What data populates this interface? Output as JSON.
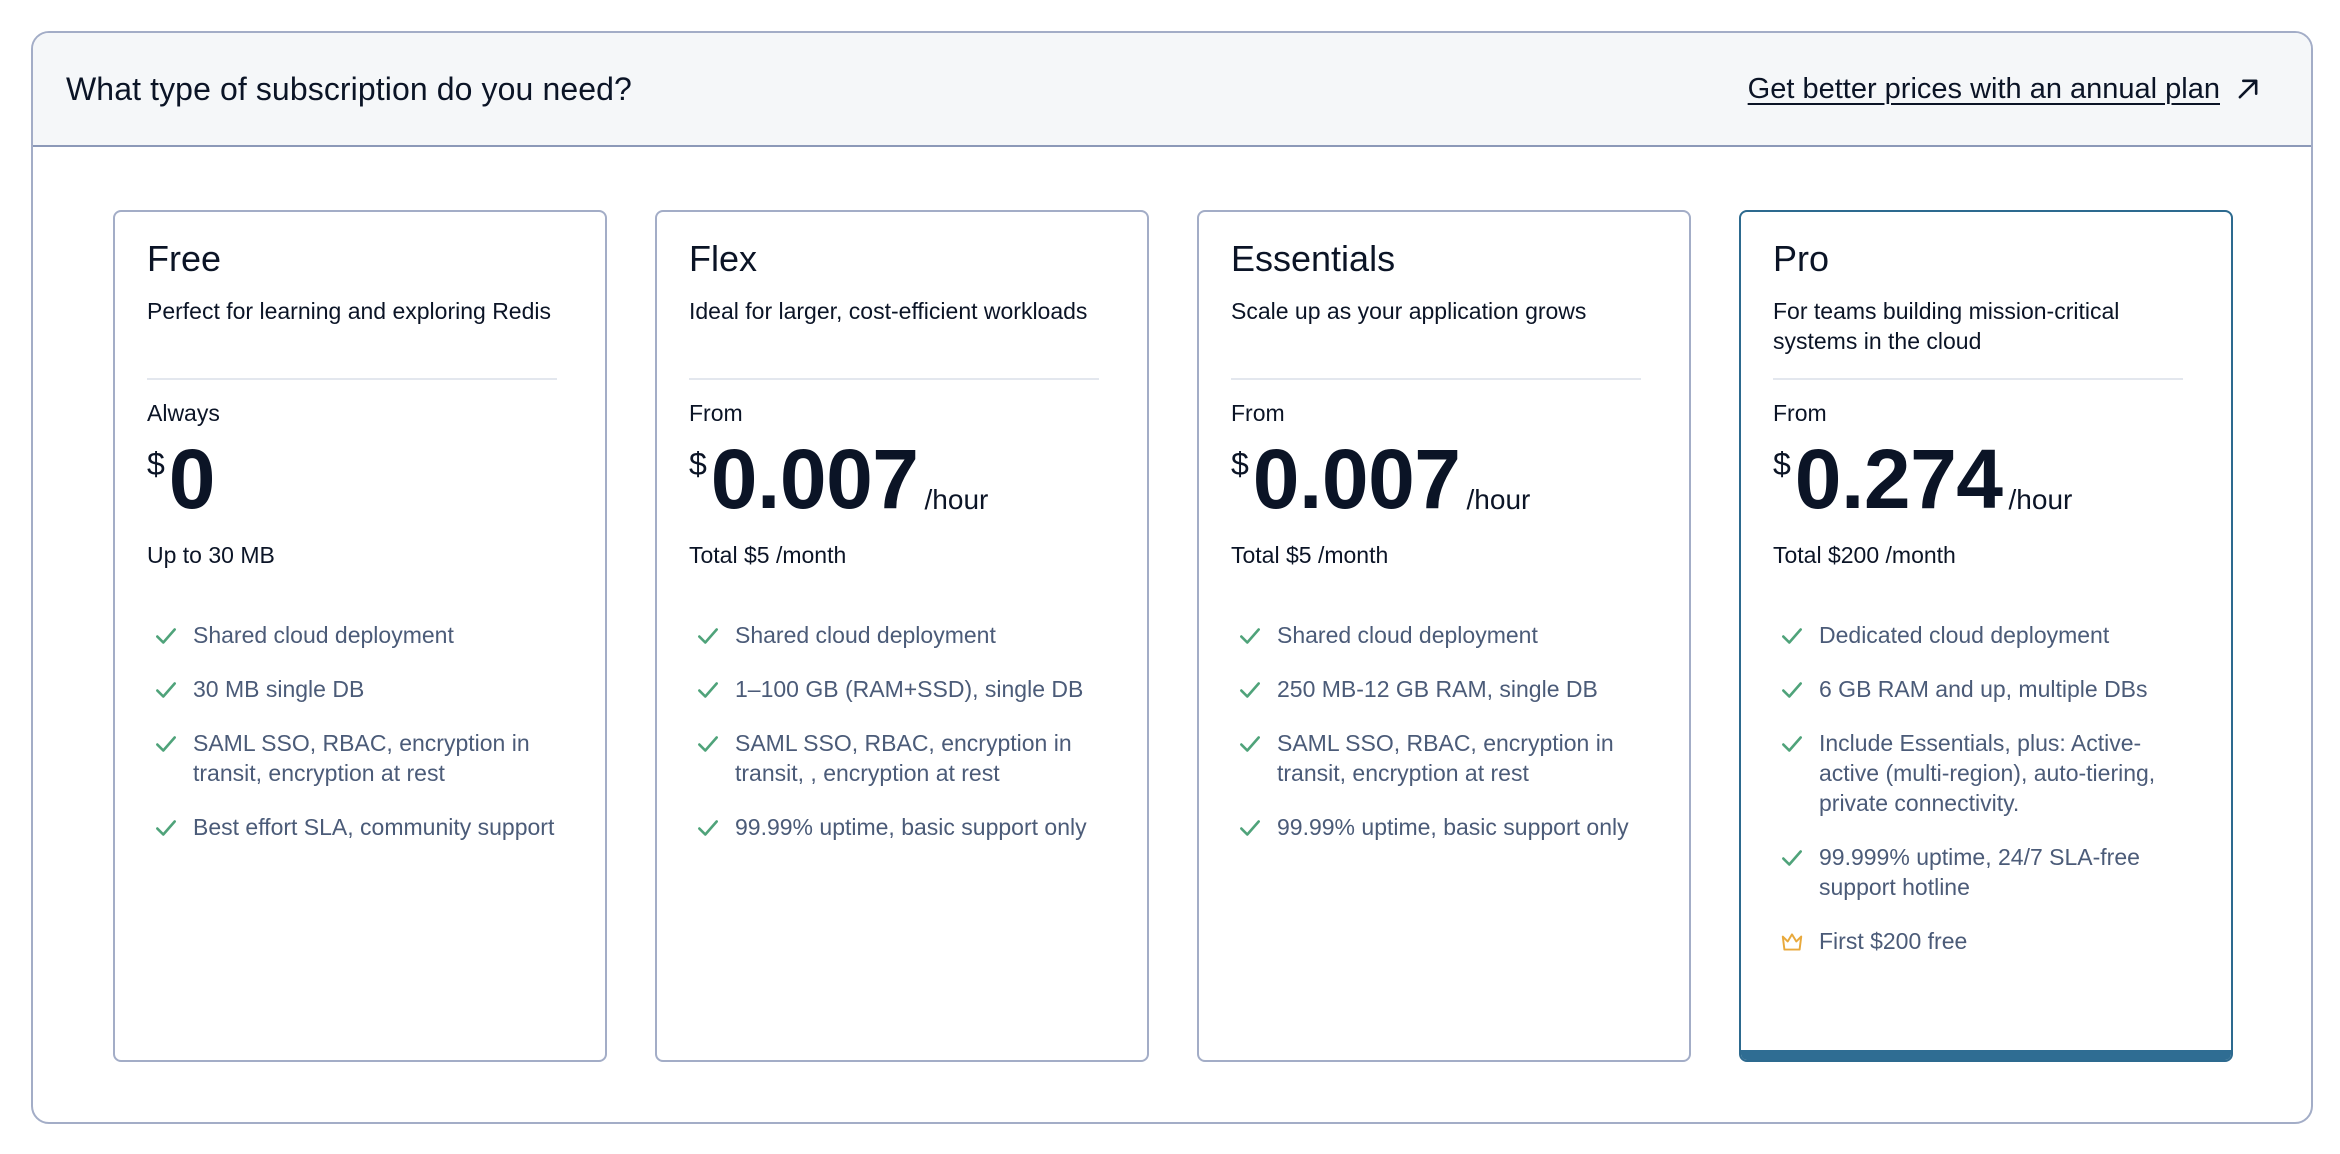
{
  "header": {
    "title": "What type of subscription do you need?",
    "annual_link": "Get better prices with an annual plan"
  },
  "colors": {
    "check": "#4fa37a",
    "crown": "#e8a93c",
    "pro_accent": "#2f6d93",
    "border": "#a3adc7"
  },
  "plans": [
    {
      "name": "Free",
      "description": "Perfect for learning and exploring Redis",
      "price_label": "Always",
      "currency": "$",
      "price": "0",
      "unit": "",
      "total": "Up to 30 MB",
      "features": [
        {
          "icon": "check-icon",
          "text": "Shared cloud deployment"
        },
        {
          "icon": "check-icon",
          "text": "30 MB single DB"
        },
        {
          "icon": "check-icon",
          "text": "SAML SSO, RBAC, encryption in transit, encryption at rest"
        },
        {
          "icon": "check-icon",
          "text": "Best effort SLA, community support"
        }
      ]
    },
    {
      "name": "Flex",
      "description": "Ideal for larger, cost-efficient workloads",
      "price_label": "From",
      "currency": "$",
      "price": "0.007",
      "unit": "/hour",
      "total": "Total $5 /month",
      "features": [
        {
          "icon": "check-icon",
          "text": "Shared cloud deployment"
        },
        {
          "icon": "check-icon",
          "text": "1–100 GB (RAM+SSD), single DB"
        },
        {
          "icon": "check-icon",
          "text": "SAML SSO, RBAC, encryption in transit, , encryption at rest"
        },
        {
          "icon": "check-icon",
          "text": "99.99% uptime, basic support only"
        }
      ]
    },
    {
      "name": "Essentials",
      "description": "Scale up as your application grows",
      "price_label": "From",
      "currency": "$",
      "price": "0.007",
      "unit": "/hour",
      "total": "Total $5 /month",
      "features": [
        {
          "icon": "check-icon",
          "text": "Shared cloud deployment"
        },
        {
          "icon": "check-icon",
          "text": "250 MB-12 GB RAM, single DB"
        },
        {
          "icon": "check-icon",
          "text": "SAML SSO, RBAC, encryption in transit, encryption at rest"
        },
        {
          "icon": "check-icon",
          "text": "99.99% uptime, basic support only"
        }
      ]
    },
    {
      "name": "Pro",
      "description": "For teams building mission-critical systems in the cloud",
      "price_label": "From",
      "currency": "$",
      "price": "0.274",
      "unit": "/hour",
      "total": "Total $200 /month",
      "features": [
        {
          "icon": "check-icon",
          "text": "Dedicated cloud deployment"
        },
        {
          "icon": "check-icon",
          "text": "6 GB RAM and up, multiple DBs"
        },
        {
          "icon": "check-icon",
          "text": "Include Essentials, plus: Active-active (multi-region), auto-tiering, private connectivity."
        },
        {
          "icon": "check-icon",
          "text": "99.999% uptime, 24/7 SLA-free support hotline"
        },
        {
          "icon": "crown-icon",
          "text": "First $200 free"
        }
      ]
    }
  ]
}
